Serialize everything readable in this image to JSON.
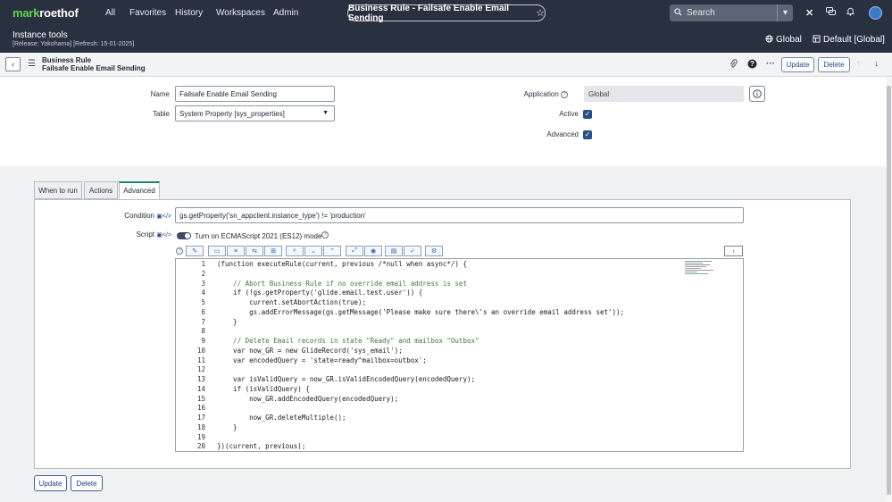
{
  "brand": {
    "part1": "mark",
    "part2": "roethof"
  },
  "nav": {
    "all": "All",
    "favorites": "Favorites",
    "history": "History",
    "workspaces": "Workspaces",
    "admin": "Admin"
  },
  "record_pill": {
    "title": "Business Rule - Failsafe Enable Email Sending",
    "star": "☆"
  },
  "search": {
    "placeholder": "Search"
  },
  "instance": {
    "title": "Instance tools",
    "sub": "[Release: Yokohama] [Refresh: 15-01-2025]",
    "scope": "Global",
    "update_set": "Default [Global]"
  },
  "form_header": {
    "type": "Business Rule",
    "name": "Failsafe Enable Email Sending",
    "update": "Update",
    "delete": "Delete"
  },
  "fields": {
    "name_label": "Name",
    "name_value": "Failsafe Enable Email Sending",
    "table_label": "Table",
    "table_value": "System Property [sys_properties]",
    "application_label": "Application",
    "application_value": "Global",
    "active_label": "Active",
    "advanced_label": "Advanced"
  },
  "tabs": [
    "When to run",
    "Actions",
    "Advanced"
  ],
  "advanced": {
    "condition_label": "Condition",
    "condition_value": "gs.getProperty('sn_appclient.instance_type') != 'production'",
    "script_label": "Script",
    "ecma_label": "Turn on ECMAScript 2021 (ES12) mode"
  },
  "code_lines": [
    "(function executeRule(current, previous /*null when async*/) {",
    "",
    "    // Abort Business Rule if no override email address is set",
    "    if (!gs.getProperty('glide.email.test.user')) {",
    "        current.setAbortAction(true);",
    "        gs.addErrorMessage(gs.getMessage('Please make sure there\\'s an override email address set'));",
    "    }",
    "",
    "    // Delete Email records in state \"Ready\" and mailbox \"Outbox\"",
    "    var now_GR = new GlideRecord('sys_email');",
    "    var encodedQuery = 'state=ready^mailbox=outbox';",
    "",
    "    var isValidQuery = now_GR.isValidEncodedQuery(encodedQuery);",
    "    if (isValidQuery) {",
    "        now_GR.addEncodedQuery(encodedQuery);",
    "",
    "        now_GR.deleteMultiple();",
    "    }",
    "",
    "})(current, previous);"
  ],
  "line_numbers": [
    "1",
    "2",
    "3",
    "4",
    "5",
    "6",
    "7",
    "8",
    "9",
    "10",
    "11",
    "12",
    "13",
    "14",
    "15",
    "16",
    "17",
    "18",
    "19",
    "20"
  ],
  "bottom": {
    "update": "Update",
    "delete": "Delete"
  }
}
